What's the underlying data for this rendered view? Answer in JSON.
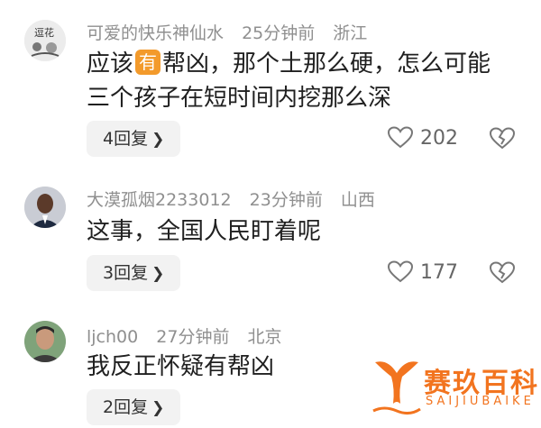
{
  "comments": [
    {
      "username": "可爱的快乐神仙水",
      "time": "25分钟前",
      "location": "浙江",
      "text_before": "应该",
      "badge": "有",
      "text_after": "帮凶，那个土那么硬，怎么可能",
      "text_line2": "三个孩子在短时间内挖那么深",
      "replies": "4回复",
      "likes": "202"
    },
    {
      "username": "大漠孤烟2233012",
      "time": "23分钟前",
      "location": "山西",
      "text": "这事，全国人民盯着呢",
      "replies": "3回复",
      "likes": "177"
    },
    {
      "username": "ljch00",
      "time": "27分钟前",
      "location": "北京",
      "text": "我反正怀疑有帮凶",
      "replies": "2回复"
    }
  ],
  "avatar_text": "逗花",
  "watermark": {
    "name": "赛玖百科",
    "sub": "SAIJIUBAIKE"
  },
  "colors": {
    "badge": "#f39a2b",
    "watermark": "#f2741f",
    "meta": "#8f8f8f"
  }
}
